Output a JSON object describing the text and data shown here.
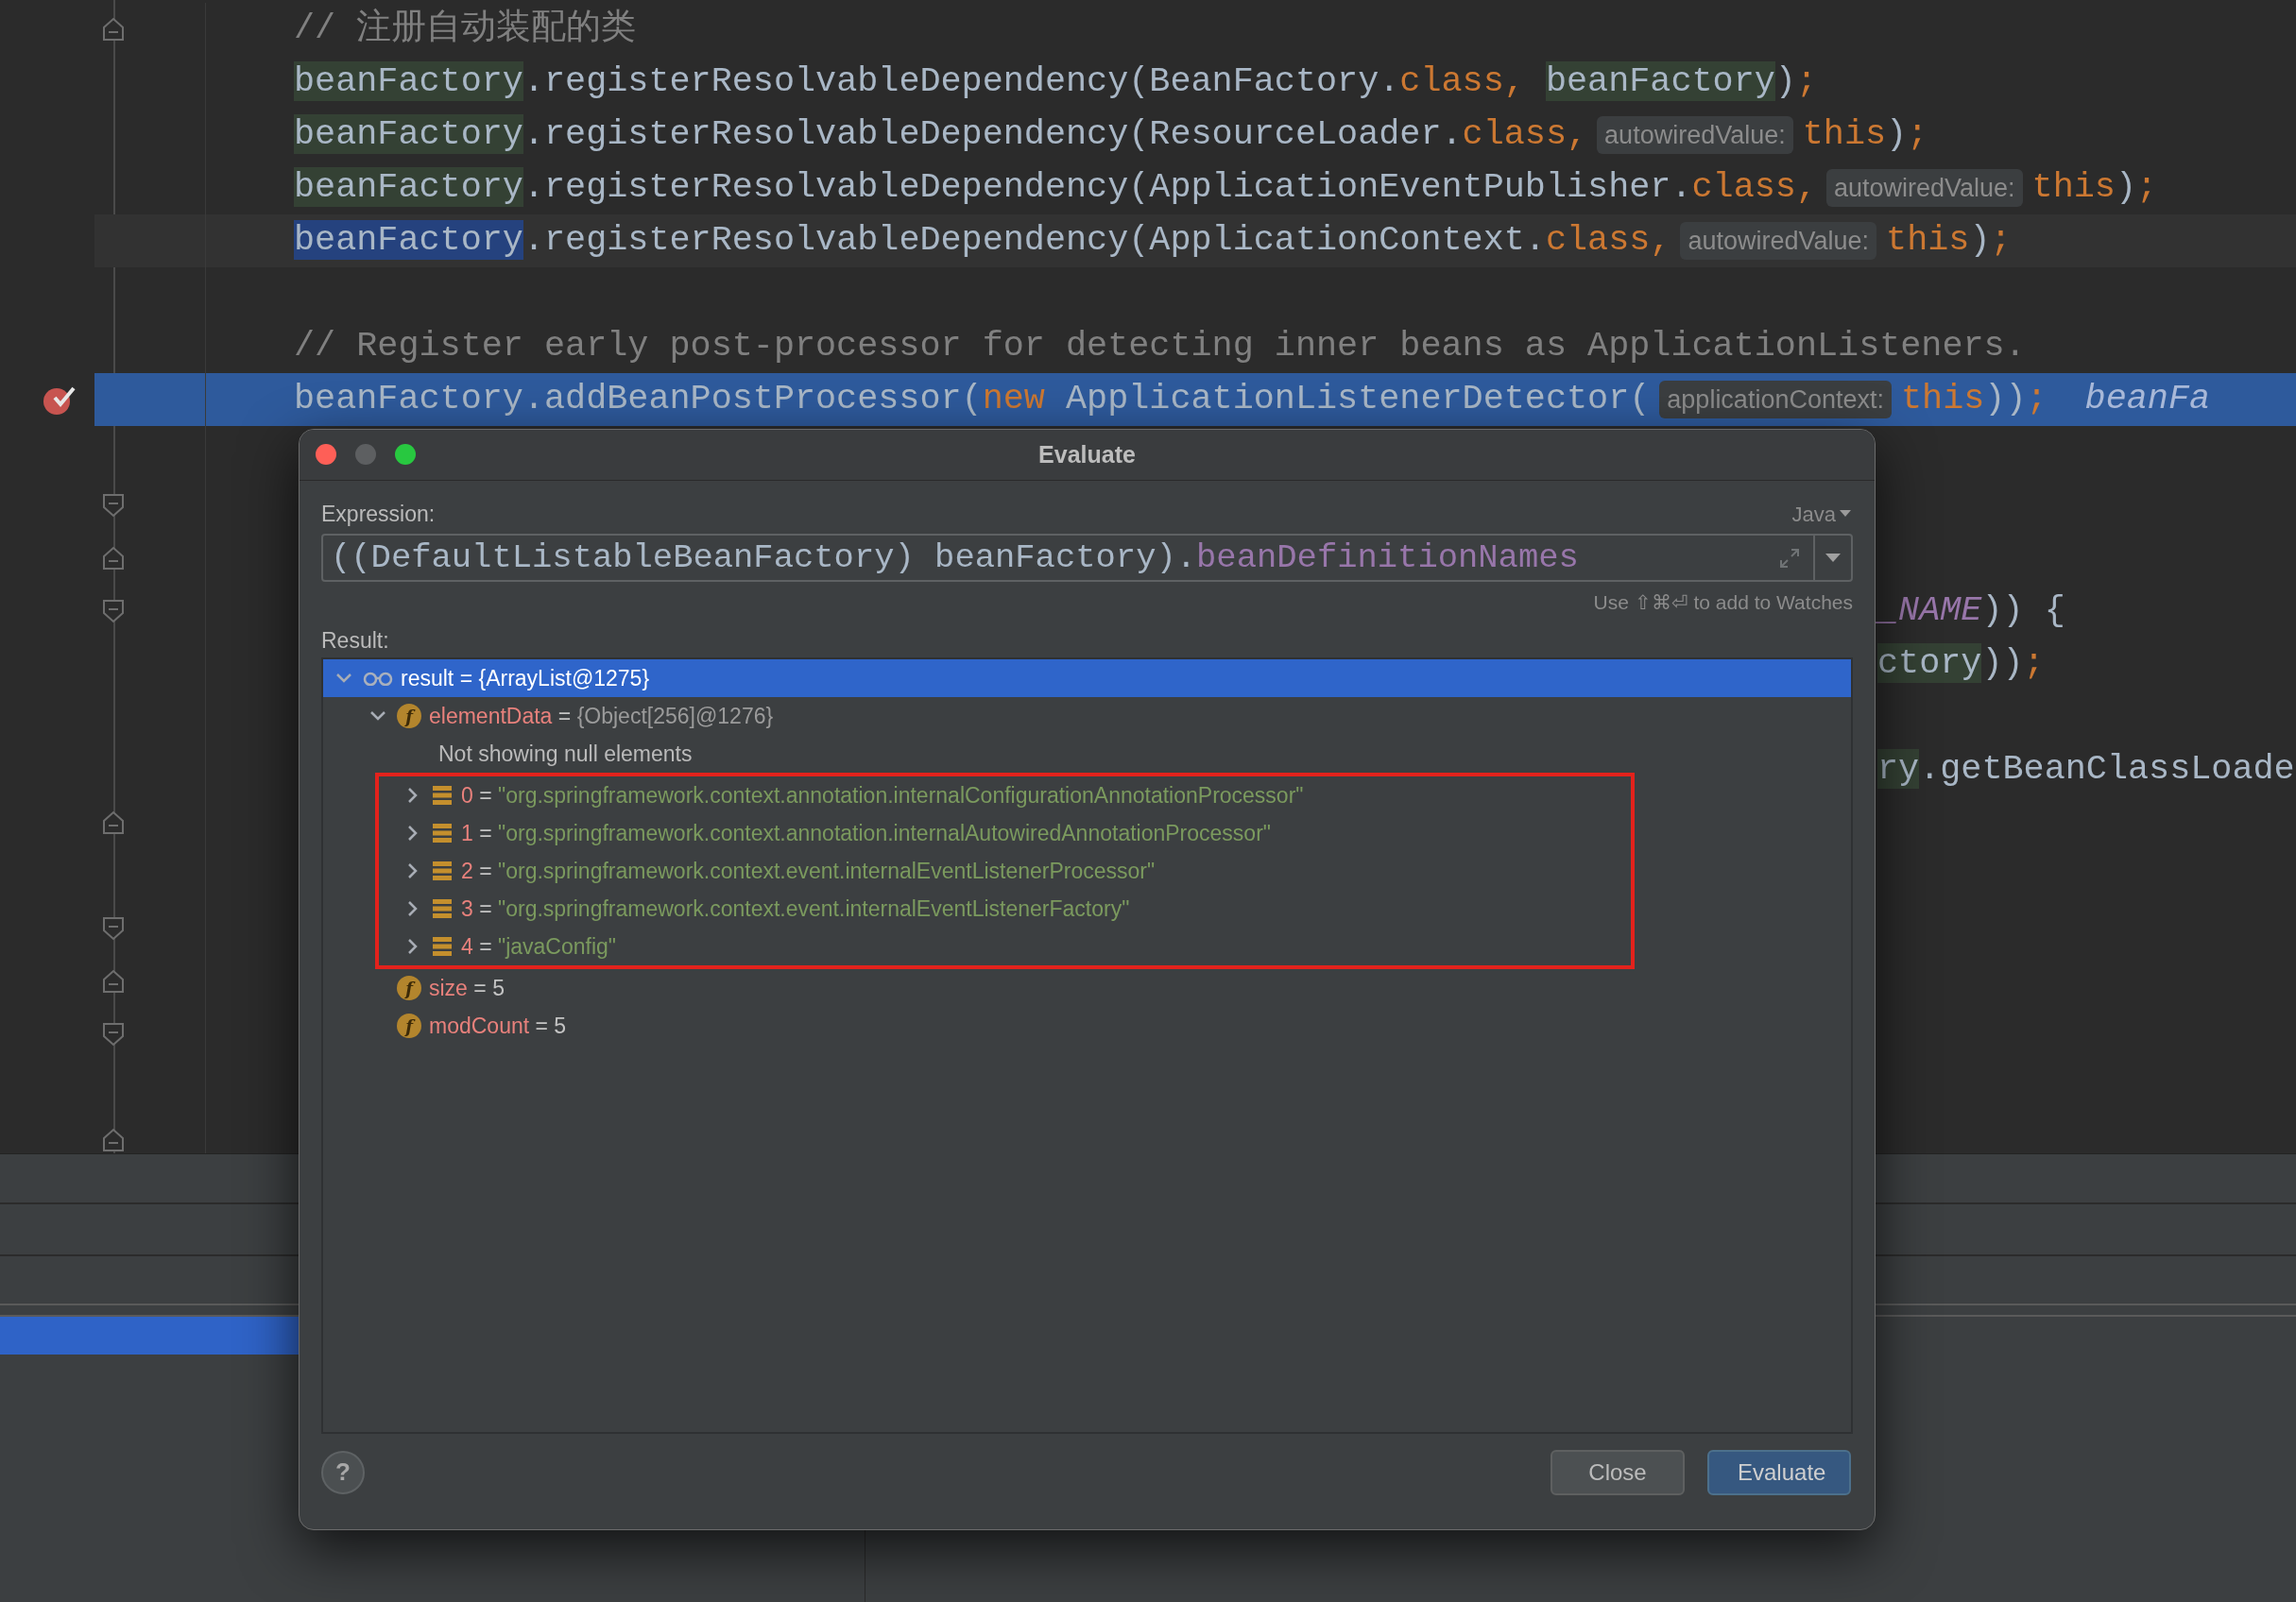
{
  "editor": {
    "lines": [
      {
        "kind": "plain",
        "fold_end": true,
        "segments": [
          {
            "kind": "comment",
            "text": "// 注册自动装配的类"
          }
        ]
      },
      {
        "kind": "plain",
        "segments": [
          {
            "kind": "usage",
            "text": "beanFactory"
          },
          {
            "kind": "plain",
            "text": ".registerResolvableDependency(BeanFactory."
          },
          {
            "kind": "keyword",
            "text": "class, "
          },
          {
            "kind": "usage",
            "text": "beanFactory"
          },
          {
            "kind": "plain",
            "text": ")"
          },
          {
            "kind": "keyword",
            "text": ";"
          }
        ]
      },
      {
        "kind": "plain",
        "segments": [
          {
            "kind": "usage",
            "text": "beanFactory"
          },
          {
            "kind": "plain",
            "text": ".registerResolvableDependency(ResourceLoader."
          },
          {
            "kind": "keyword",
            "text": "class,"
          },
          {
            "kind": "hint",
            "text": "autowiredValue:"
          },
          {
            "kind": "keyword",
            "text": "this"
          },
          {
            "kind": "plain",
            "text": ")"
          },
          {
            "kind": "keyword",
            "text": ";"
          }
        ]
      },
      {
        "kind": "plain",
        "segments": [
          {
            "kind": "usage",
            "text": "beanFactory"
          },
          {
            "kind": "plain",
            "text": ".registerResolvableDependency(ApplicationEventPublisher."
          },
          {
            "kind": "keyword",
            "text": "class,"
          },
          {
            "kind": "hint",
            "text": "autowiredValue:"
          },
          {
            "kind": "keyword",
            "text": "this"
          },
          {
            "kind": "plain",
            "text": ")"
          },
          {
            "kind": "keyword",
            "text": ";"
          }
        ]
      },
      {
        "kind": "caret",
        "segments": [
          {
            "kind": "usage-write",
            "text": "beanFactory"
          },
          {
            "kind": "plain",
            "text": ".registerResolvableDependency(ApplicationContext."
          },
          {
            "kind": "keyword",
            "text": "class,"
          },
          {
            "kind": "hint",
            "text": "autowiredValue:"
          },
          {
            "kind": "keyword",
            "text": "this"
          },
          {
            "kind": "plain",
            "text": ")"
          },
          {
            "kind": "keyword",
            "text": ";"
          }
        ]
      },
      {
        "kind": "plain"
      },
      {
        "kind": "plain",
        "segments": [
          {
            "kind": "comment",
            "text": "// Register early post-processor for detecting inner beans as ApplicationListeners."
          }
        ]
      },
      {
        "kind": "execution",
        "breakpoint_set": true,
        "segments": [
          {
            "kind": "plain",
            "text": "beanFactory.addBeanPostProcessor("
          },
          {
            "kind": "keyword",
            "text": "new"
          },
          {
            "kind": "plain",
            "text": " ApplicationListenerDetector("
          },
          {
            "kind": "hint",
            "text": "applicationContext:"
          },
          {
            "kind": "keyword",
            "text": "this"
          },
          {
            "kind": "plain",
            "text": "))"
          },
          {
            "kind": "keyword",
            "text": ";"
          },
          {
            "kind": "debug",
            "text": "beanFa"
          }
        ]
      },
      {
        "kind": "plain"
      },
      {
        "kind": "plain",
        "fold_start": true
      },
      {
        "kind": "plain",
        "fold_end": true
      },
      {
        "kind": "plain",
        "fold_start": true,
        "clipped": true,
        "segments": [
          {
            "kind": "constant",
            "text": "_NAME"
          },
          {
            "kind": "plain",
            "text": ")) {"
          }
        ]
      },
      {
        "kind": "plain",
        "clipped": true,
        "segments": [
          {
            "kind": "usage",
            "text": "ctory"
          },
          {
            "kind": "plain",
            "text": "))"
          },
          {
            "kind": "keyword",
            "text": ";"
          }
        ]
      },
      {
        "kind": "plain"
      },
      {
        "kind": "plain",
        "clipped": true,
        "segments": [
          {
            "kind": "usage",
            "text": "ry"
          },
          {
            "kind": "plain",
            "text": ".getBeanClassLoade"
          }
        ]
      },
      {
        "kind": "plain",
        "fold_end": true
      },
      {
        "kind": "plain"
      },
      {
        "kind": "plain",
        "fold_start": true
      },
      {
        "kind": "plain",
        "fold_end": true
      },
      {
        "kind": "plain",
        "fold_start": true
      },
      {
        "kind": "plain"
      },
      {
        "kind": "plain",
        "fold_end": true
      }
    ]
  },
  "dialog": {
    "title": "Evaluate",
    "expression_label": "Expression:",
    "language": "Java",
    "expression": [
      {
        "kind": "plain",
        "text": "((DefaultListableBeanFactory) beanFactory)."
      },
      {
        "kind": "field",
        "text": "beanDefinitionNames"
      }
    ],
    "hint": "Use ⇧⌘⏎ to add to Watches",
    "result_label": "Result:",
    "tree": [
      {
        "kind": "watch",
        "name": "result",
        "eq": "=",
        "value": "{ArrayList@1275}",
        "expanded": true,
        "selected": true,
        "children": [
          {
            "kind": "field-object",
            "badge": "f",
            "name": "elementData",
            "eq": "=",
            "value": "{Object[256]@1276}",
            "expanded": true,
            "selected": false,
            "children": [
              {
                "kind": "message",
                "text": "Not showing null elements"
              },
              {
                "kind": "element-string",
                "name": "0",
                "eq": "=",
                "value": "\"org.springframework.context.annotation.internalConfigurationAnnotationProcessor\"",
                "expanded": false,
                "selected": false,
                "annotated": true
              },
              {
                "kind": "element-string",
                "name": "1",
                "eq": "=",
                "value": "\"org.springframework.context.annotation.internalAutowiredAnnotationProcessor\"",
                "expanded": false,
                "selected": false,
                "annotated": true
              },
              {
                "kind": "element-string",
                "name": "2",
                "eq": "=",
                "value": "\"org.springframework.context.event.internalEventListenerProcessor\"",
                "expanded": false,
                "selected": false,
                "annotated": true
              },
              {
                "kind": "element-string",
                "name": "3",
                "eq": "=",
                "value": "\"org.springframework.context.event.internalEventListenerFactory\"",
                "expanded": false,
                "selected": false,
                "annotated": true
              },
              {
                "kind": "element-string",
                "name": "4",
                "eq": "=",
                "value": "\"javaConfig\"",
                "expanded": false,
                "selected": false,
                "annotated": true
              }
            ]
          },
          {
            "kind": "field-number",
            "badge": "f",
            "name": "size",
            "eq": "=",
            "value": "5",
            "selected": false
          },
          {
            "kind": "field-number",
            "badge": "f",
            "name": "modCount",
            "eq": "=",
            "value": "5",
            "selected": false
          }
        ]
      }
    ],
    "help": "?",
    "buttons": [
      {
        "label": "Close",
        "default": false
      },
      {
        "label": "Evaluate",
        "default": true
      }
    ]
  }
}
